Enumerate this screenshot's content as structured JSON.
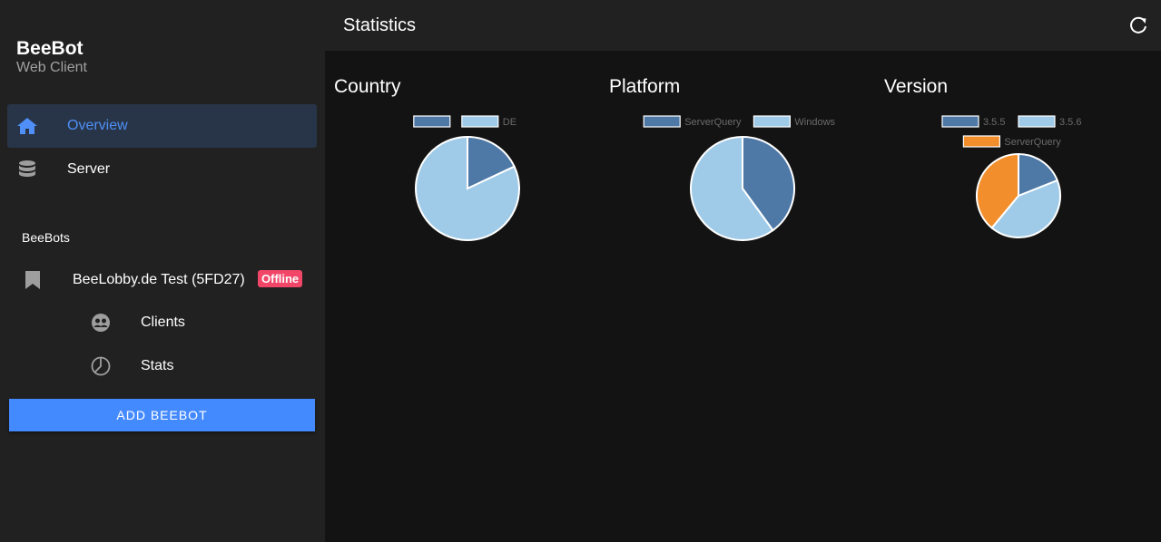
{
  "app": {
    "title": "BeeBot",
    "subtitle": "Web Client"
  },
  "nav": [
    {
      "label": "Overview",
      "icon": "home-icon",
      "active": true
    },
    {
      "label": "Server",
      "icon": "database-icon",
      "active": false
    }
  ],
  "sidebar": {
    "section_label": "BeeBots",
    "bot": {
      "label": "BeeLobby.de Test (5FD27)",
      "status": "Offline",
      "icon": "bookmark-icon"
    },
    "sub_items": [
      {
        "label": "Clients",
        "icon": "users-icon"
      },
      {
        "label": "Stats",
        "icon": "pie-chart-icon"
      }
    ],
    "add_button": "ADD BEEBOT"
  },
  "header": {
    "title": "Statistics",
    "refresh_icon": "refresh-icon"
  },
  "colors": {
    "accent": "#448aff",
    "active_bg": "#283548",
    "badge": "#f14668",
    "series_dark_blue": "#4e79a7",
    "series_light_blue": "#a0cbe8",
    "series_orange": "#f28e2b"
  },
  "chart_data": [
    {
      "type": "pie",
      "title": "Country",
      "categories": [
        "",
        "DE"
      ],
      "values": [
        18,
        82
      ]
    },
    {
      "type": "pie",
      "title": "Platform",
      "categories": [
        "ServerQuery",
        "Windows"
      ],
      "values": [
        40,
        60
      ]
    },
    {
      "type": "pie",
      "title": "Version",
      "categories": [
        "3.5.5",
        "3.5.6",
        "ServerQuery"
      ],
      "values": [
        19,
        42,
        39
      ]
    }
  ]
}
